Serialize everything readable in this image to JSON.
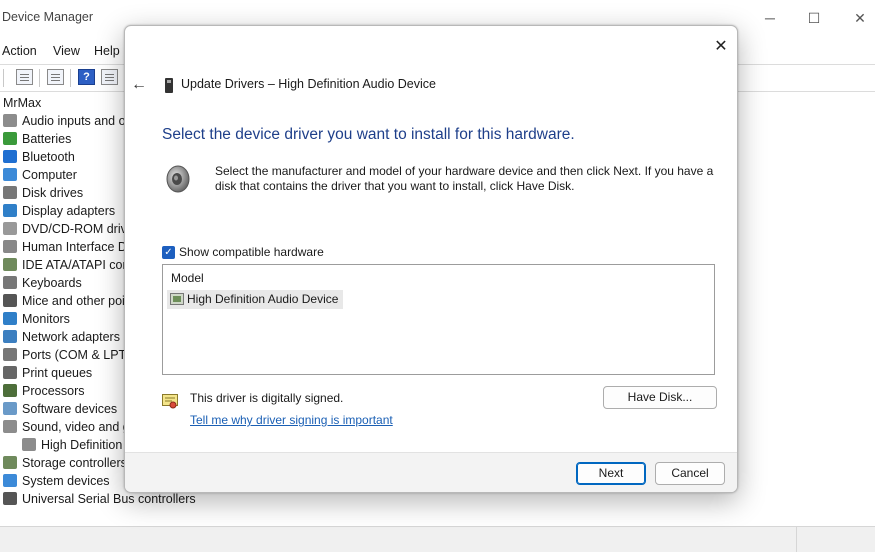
{
  "window": {
    "title": "Device Manager",
    "controls": {
      "minimize": "─",
      "maximize": "☐",
      "close": "✕"
    }
  },
  "menu": [
    "Action",
    "View",
    "Help"
  ],
  "tree": {
    "root": "MrMax",
    "items": [
      {
        "label": "Audio inputs and o",
        "icon": "audio-icon",
        "color": "#8c8c8c"
      },
      {
        "label": "Batteries",
        "icon": "battery-icon",
        "color": "#3a9a3a"
      },
      {
        "label": "Bluetooth",
        "icon": "bluetooth-icon",
        "color": "#1f6fd1"
      },
      {
        "label": "Computer",
        "icon": "computer-icon",
        "color": "#3c8ad8"
      },
      {
        "label": "Disk drives",
        "icon": "disk-icon",
        "color": "#777777"
      },
      {
        "label": "Display adapters",
        "icon": "display-icon",
        "color": "#2f7fc8"
      },
      {
        "label": "DVD/CD-ROM drive",
        "icon": "dvd-icon",
        "color": "#999999"
      },
      {
        "label": "Human Interface De",
        "icon": "hid-icon",
        "color": "#888888"
      },
      {
        "label": "IDE ATA/ATAPI cont",
        "icon": "ide-icon",
        "color": "#6f8a5c"
      },
      {
        "label": "Keyboards",
        "icon": "keyboard-icon",
        "color": "#777777"
      },
      {
        "label": "Mice and other poi",
        "icon": "mouse-icon",
        "color": "#555555"
      },
      {
        "label": "Monitors",
        "icon": "monitor-icon",
        "color": "#2f7fc8"
      },
      {
        "label": "Network adapters",
        "icon": "network-icon",
        "color": "#3c7fc0"
      },
      {
        "label": "Ports (COM & LPT)",
        "icon": "port-icon",
        "color": "#777777"
      },
      {
        "label": "Print queues",
        "icon": "printer-icon",
        "color": "#666666"
      },
      {
        "label": "Processors",
        "icon": "processor-icon",
        "color": "#4d6e3a"
      },
      {
        "label": "Software devices",
        "icon": "software-icon",
        "color": "#6a9ac8"
      },
      {
        "label": "Sound, video and g",
        "icon": "sound-icon",
        "color": "#8c8c8c"
      },
      {
        "label": "High Definition",
        "icon": "speaker-icon",
        "color": "#8c8c8c",
        "child": true
      },
      {
        "label": "Storage controllers",
        "icon": "storage-icon",
        "color": "#6f8a5c"
      },
      {
        "label": "System devices",
        "icon": "system-icon",
        "color": "#3c8ad8"
      },
      {
        "label": "Universal Serial Bus controllers",
        "icon": "usb-icon",
        "color": "#555555"
      }
    ]
  },
  "dialog": {
    "header_title": "Update Drivers – High Definition Audio Device",
    "close": "✕",
    "back": "←",
    "heading": "Select the device driver you want to install for this hardware.",
    "description": "Select the manufacturer and model of your hardware device and then click Next. If you have a disk that contains the driver that you want to install, click Have Disk.",
    "show_compatible_label": "Show compatible hardware",
    "show_compatible_checked": true,
    "list_header": "Model",
    "models": [
      "High Definition Audio Device"
    ],
    "signed_text": "This driver is digitally signed.",
    "signed_link": "Tell me why driver signing is important",
    "have_disk": "Have Disk...",
    "next": "Next",
    "cancel": "Cancel"
  }
}
